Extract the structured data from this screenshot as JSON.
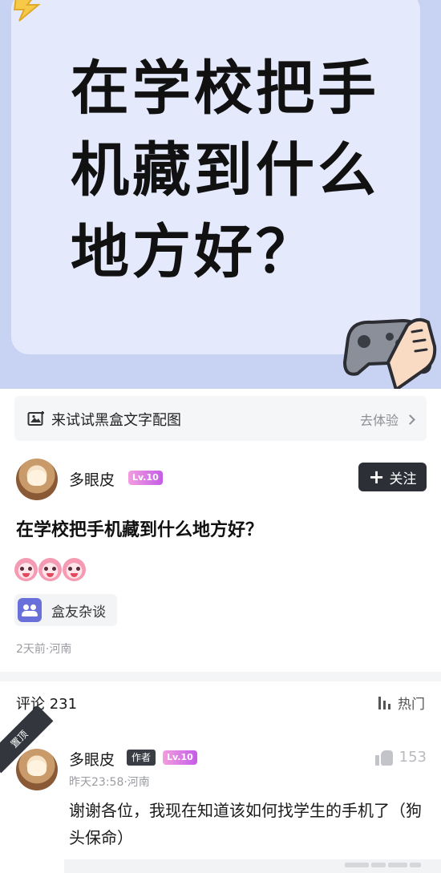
{
  "hero": {
    "line1": "在学校把手",
    "line2": "机藏到什么",
    "line3": "地方好？"
  },
  "promo": {
    "text": "来试试黑盒文字配图",
    "action": "去体验",
    "icon": "image-edit-icon"
  },
  "post": {
    "username": "多眼皮",
    "level": "Lv.10",
    "follow_label": "关注",
    "title": "在学校把手机藏到什么地方好？",
    "emoji_count": 3,
    "topic": "盒友杂谈",
    "meta": "2天前·河南"
  },
  "comments": {
    "header": "评论 231",
    "sort_label": "热门",
    "items": [
      {
        "pinned_label": "置顶",
        "username": "多眼皮",
        "author_tag": "作者",
        "level": "Lv.10",
        "likes": "153",
        "meta": "昨天23:58·河南",
        "text": "谢谢各位，我现在知道该如何找学生的手机了（狗头保命）"
      }
    ]
  },
  "colors": {
    "hero_bg": "#c8d2f3",
    "hero_card": "#e4e9fb",
    "follow_btn": "#2c2f36",
    "level_badge": "#c45ce8",
    "topic_icon": "#6a70d9"
  }
}
